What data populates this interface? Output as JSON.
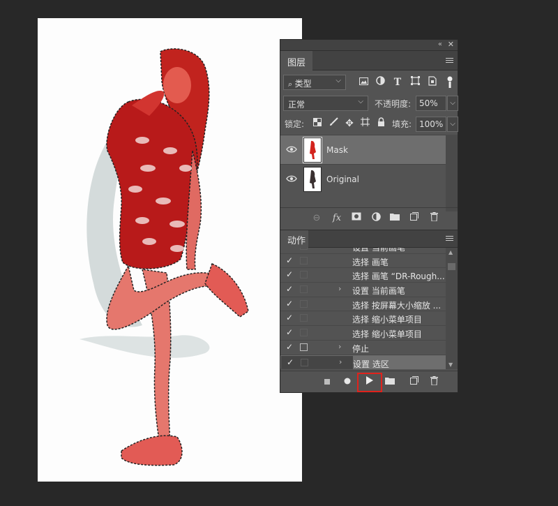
{
  "panel": {
    "title_controls": {
      "collapse": "«",
      "close": "✕"
    }
  },
  "layers_panel": {
    "tab_label": "图层",
    "filter": {
      "label": "类型",
      "icons": [
        "image-filter-icon",
        "adjustment-filter-icon",
        "type-filter-icon",
        "shape-filter-icon",
        "smart-object-filter-icon"
      ]
    },
    "blend_mode": "正常",
    "opacity_label": "不透明度:",
    "opacity_value": "50%",
    "lock_label": "锁定:",
    "fill_label": "填充:",
    "fill_value": "100%",
    "layers": [
      {
        "name": "Mask",
        "visible": true,
        "selected": true
      },
      {
        "name": "Original",
        "visible": true,
        "selected": false
      }
    ]
  },
  "actions_panel": {
    "tab_label": "动作",
    "rows": [
      {
        "checked": true,
        "dialog": false,
        "expandable": true,
        "text": "设置 当前画笔",
        "selected": false
      },
      {
        "checked": true,
        "dialog": false,
        "expandable": false,
        "text": "选择 画笔",
        "selected": false
      },
      {
        "checked": true,
        "dialog": false,
        "expandable": false,
        "text": "选择 画笔 “DR-Rough...",
        "selected": false
      },
      {
        "checked": true,
        "dialog": false,
        "expandable": true,
        "text": "设置 当前画笔",
        "selected": false
      },
      {
        "checked": true,
        "dialog": false,
        "expandable": false,
        "text": "选择 按屏幕大小缩放 ...",
        "selected": false
      },
      {
        "checked": true,
        "dialog": false,
        "expandable": false,
        "text": "选择 缩小菜单项目",
        "selected": false
      },
      {
        "checked": true,
        "dialog": false,
        "expandable": false,
        "text": "选择 缩小菜单项目",
        "selected": false
      },
      {
        "checked": true,
        "dialog": true,
        "expandable": true,
        "text": "停止",
        "selected": false
      },
      {
        "checked": true,
        "dialog": false,
        "expandable": true,
        "text": "设置 选区",
        "selected": true
      }
    ]
  },
  "colors": {
    "app_bg": "#282828",
    "panel_bg": "#535353",
    "selection_bg": "#6e6e6e",
    "mask_red": "#d63a34",
    "highlight_box": "#e0221c"
  }
}
